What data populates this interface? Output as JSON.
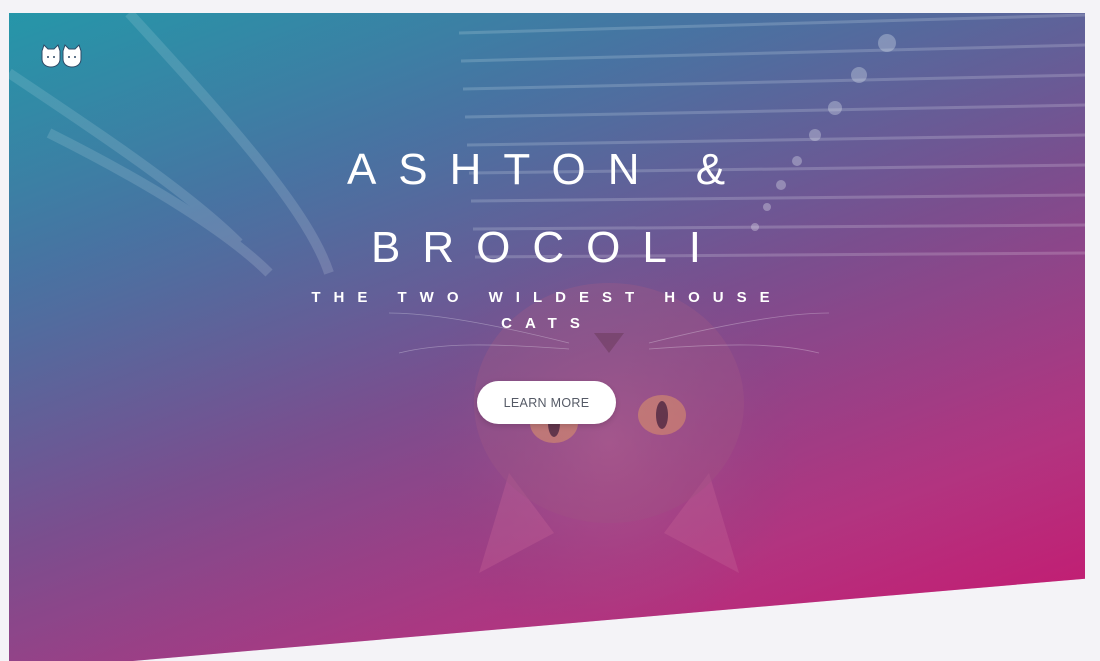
{
  "hero": {
    "title_line1": "ASHTON &",
    "title_line2": "BROCOLI",
    "subtitle_line1": "THE TWO WILDEST HOUSE",
    "subtitle_line2": "CATS",
    "cta_label": "LEARN MORE"
  },
  "icons": {
    "logo": "two-cats-logo-icon"
  },
  "colors": {
    "gradient_start": "#2a96a8",
    "gradient_end": "#c8156e",
    "page_background": "#f4f3f7",
    "button_background": "#ffffff",
    "button_text": "#555a66"
  }
}
